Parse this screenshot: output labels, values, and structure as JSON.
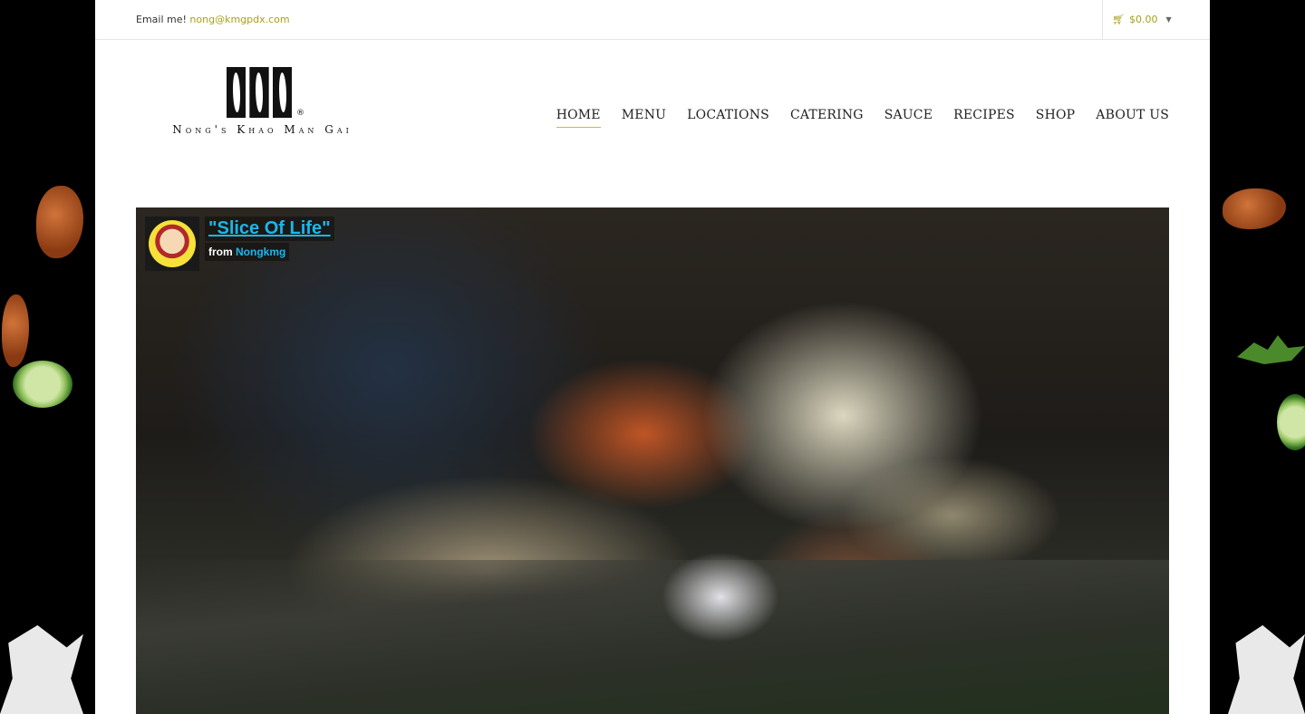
{
  "topbar": {
    "email_label": "Email me!",
    "email_address": "nong@kmgpdx.com",
    "cart_total": "$0.00"
  },
  "logo": {
    "wordmark": "Nong's Khao Man Gai",
    "registered": "®"
  },
  "nav": {
    "items": [
      {
        "label": "HOME",
        "active": true
      },
      {
        "label": "MENU"
      },
      {
        "label": "LOCATIONS"
      },
      {
        "label": "CATERING"
      },
      {
        "label": "SAUCE"
      },
      {
        "label": "RECIPES"
      },
      {
        "label": "SHOP"
      },
      {
        "label": "ABOUT US"
      }
    ]
  },
  "video": {
    "title": "\"Slice Of Life\"",
    "from_label": "from",
    "author": "Nongkmg"
  },
  "colors": {
    "accent": "#a6a01a",
    "nav_underline": "#c7bf2a",
    "video_link": "#1ab7ea"
  }
}
